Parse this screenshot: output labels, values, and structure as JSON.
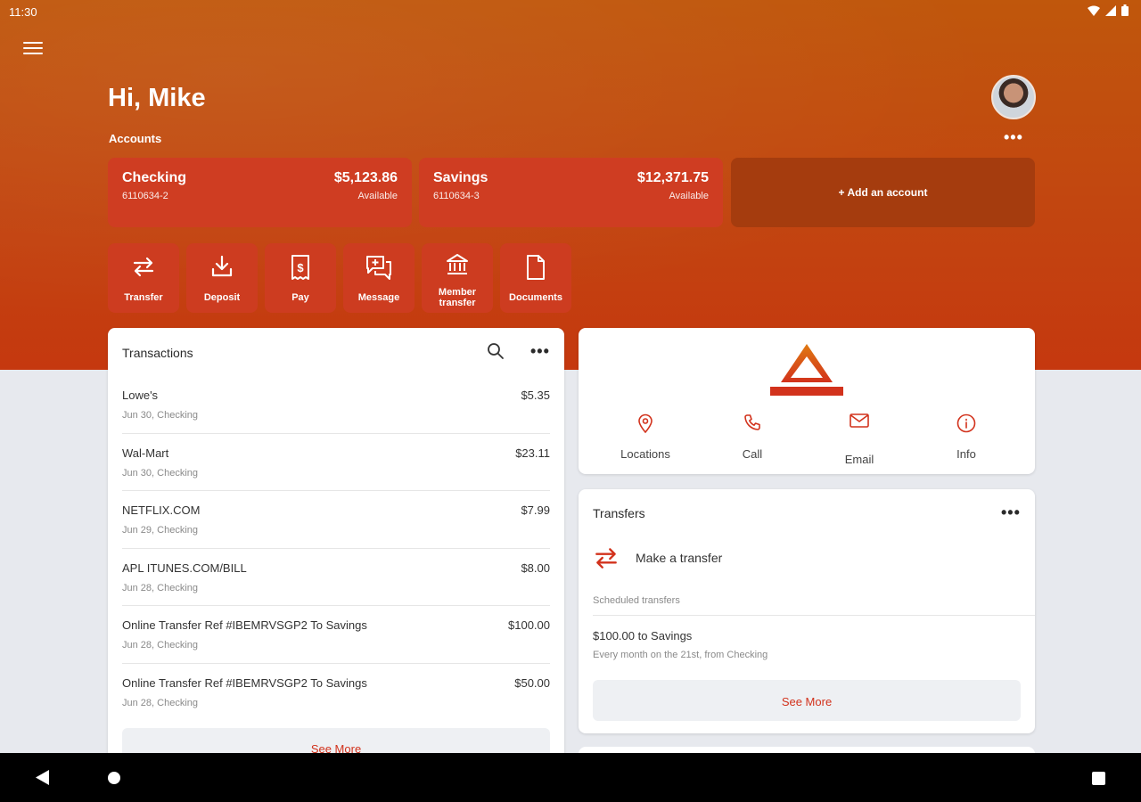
{
  "status": {
    "time": "11:30"
  },
  "header": {
    "greeting": "Hi, Mike",
    "accounts_label": "Accounts",
    "more_label": "•••"
  },
  "accounts": [
    {
      "name": "Checking",
      "number": "6110634-2",
      "balance": "$5,123.86",
      "available_label": "Available"
    },
    {
      "name": "Savings",
      "number": "6110634-3",
      "balance": "$12,371.75",
      "available_label": "Available"
    }
  ],
  "add_account": "+ Add an account",
  "actions": [
    {
      "label": "Transfer",
      "icon": "transfer-icon"
    },
    {
      "label": "Deposit",
      "icon": "deposit-icon"
    },
    {
      "label": "Pay",
      "icon": "pay-icon"
    },
    {
      "label": "Message",
      "icon": "message-icon"
    },
    {
      "label": "Member transfer",
      "icon": "bank-icon"
    },
    {
      "label": "Documents",
      "icon": "document-icon"
    }
  ],
  "transactions": {
    "title": "Transactions",
    "more_label": "•••",
    "items": [
      {
        "name": "Lowe's",
        "sub": "Jun 30, Checking",
        "amount": "$5.35"
      },
      {
        "name": "Wal-Mart",
        "sub": "Jun 30, Checking",
        "amount": "$23.11"
      },
      {
        "name": "NETFLIX.COM",
        "sub": "Jun 29, Checking",
        "amount": "$7.99"
      },
      {
        "name": "APL ITUNES.COM/BILL",
        "sub": "Jun 28, Checking",
        "amount": "$8.00"
      },
      {
        "name": "Online Transfer Ref #IBEMRVSGP2 To Savings",
        "sub": "Jun 28, Checking",
        "amount": "$100.00"
      },
      {
        "name": "Online Transfer Ref #IBEMRVSGP2 To Savings",
        "sub": "Jun 28, Checking",
        "amount": "$50.00"
      }
    ],
    "see_more": "See More"
  },
  "info": {
    "items": [
      {
        "label": "Locations",
        "icon": "location-pin-icon"
      },
      {
        "label": "Call",
        "icon": "phone-icon"
      },
      {
        "label": "Email",
        "icon": "email-icon"
      },
      {
        "label": "Info",
        "icon": "info-icon"
      }
    ]
  },
  "transfers": {
    "title": "Transfers",
    "more_label": "•••",
    "make_label": "Make a transfer",
    "scheduled_label": "Scheduled transfers",
    "scheduled_item": "$100.00 to Savings",
    "scheduled_item_sub": "Every month on the 21st, from Checking",
    "see_more": "See More"
  },
  "colors": {
    "brand": "#c24610",
    "accent_red": "#d2321c",
    "card": "#cf3d22"
  }
}
